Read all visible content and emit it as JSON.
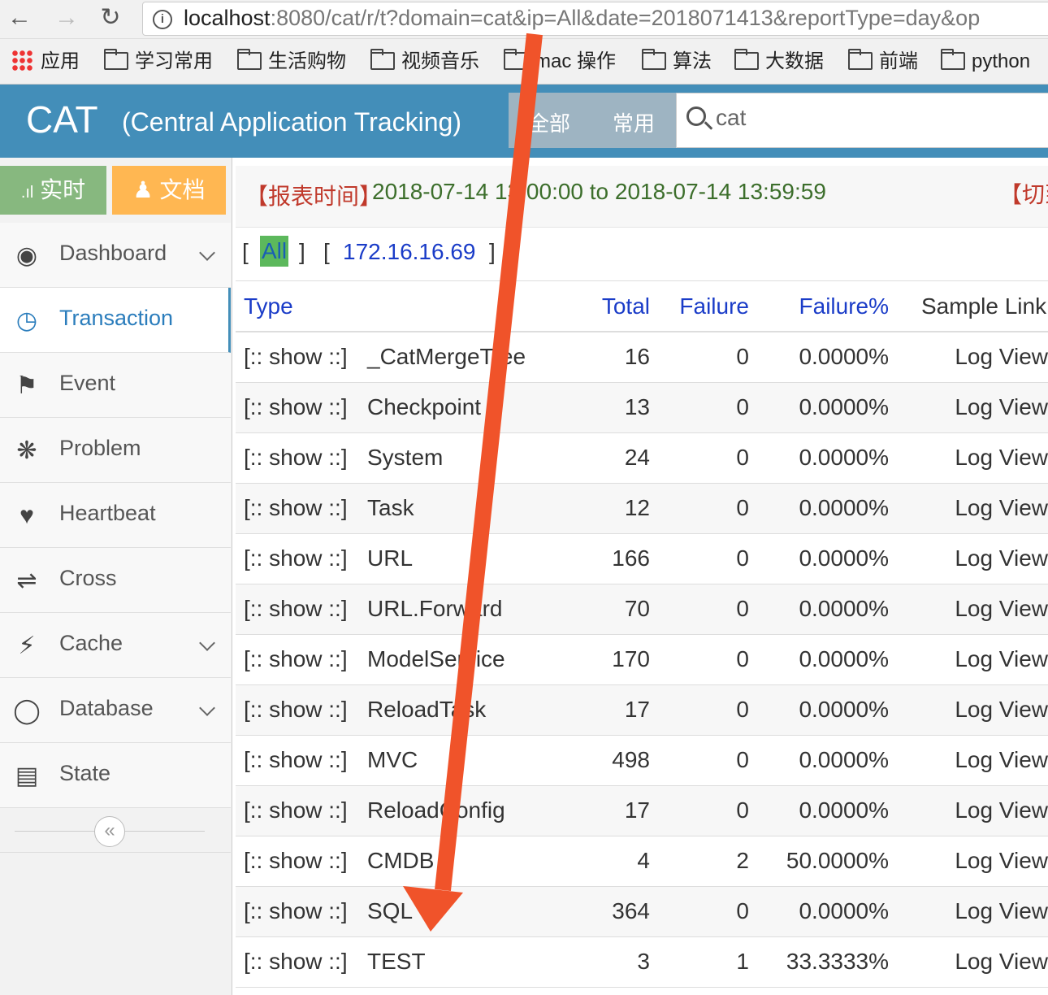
{
  "browser": {
    "url_host": "localhost",
    "url_rest": ":8080/cat/r/t?domain=cat&ip=All&date=2018071413&reportType=day&op",
    "bookmarks": [
      "应用",
      "学习常用",
      "生活购物",
      "视频音乐",
      "mac 操作",
      "算法",
      "大数据",
      "前端",
      "python"
    ]
  },
  "header": {
    "title": "CAT",
    "subtitle": "(Central Application Tracking)",
    "seg_all": "全部",
    "seg_common": "常用",
    "search_value": "cat"
  },
  "sidebar": {
    "btn_realtime": "实时",
    "btn_docs": "文档",
    "items": [
      {
        "label": "Dashboard"
      },
      {
        "label": "Transaction"
      },
      {
        "label": "Event"
      },
      {
        "label": "Problem"
      },
      {
        "label": "Heartbeat"
      },
      {
        "label": "Cross"
      },
      {
        "label": "Cache"
      },
      {
        "label": "Database"
      },
      {
        "label": "State"
      }
    ],
    "collapse_glyph": "«"
  },
  "report": {
    "label": "【报表时间】",
    "time_range": "2018-07-14 13:00:00 to 2018-07-14 13:59:59",
    "switch_label": "【切到"
  },
  "ip_filter": {
    "all": "All",
    "ip": "172.16.16.69"
  },
  "table": {
    "headers": {
      "type": "Type",
      "total": "Total",
      "failure": "Failure",
      "failure_pct": "Failure%",
      "sample": "Sample Link"
    },
    "show_text": "[:: show ::]",
    "link_text": "Log View",
    "rows": [
      {
        "type": "_CatMergeTree",
        "total": "16",
        "failure": "0",
        "pct": "0.0000%"
      },
      {
        "type": "Checkpoint",
        "total": "13",
        "failure": "0",
        "pct": "0.0000%"
      },
      {
        "type": "System",
        "total": "24",
        "failure": "0",
        "pct": "0.0000%"
      },
      {
        "type": "Task",
        "total": "12",
        "failure": "0",
        "pct": "0.0000%"
      },
      {
        "type": "URL",
        "total": "166",
        "failure": "0",
        "pct": "0.0000%"
      },
      {
        "type": "URL.Forward",
        "total": "70",
        "failure": "0",
        "pct": "0.0000%"
      },
      {
        "type": "ModelService",
        "total": "170",
        "failure": "0",
        "pct": "0.0000%"
      },
      {
        "type": "ReloadTask",
        "total": "17",
        "failure": "0",
        "pct": "0.0000%"
      },
      {
        "type": "MVC",
        "total": "498",
        "failure": "0",
        "pct": "0.0000%"
      },
      {
        "type": "ReloadConfig",
        "total": "17",
        "failure": "0",
        "pct": "0.0000%"
      },
      {
        "type": "CMDB",
        "total": "4",
        "failure": "2",
        "pct": "50.0000%"
      },
      {
        "type": "SQL",
        "total": "364",
        "failure": "0",
        "pct": "0.0000%"
      },
      {
        "type": "TEST",
        "total": "3",
        "failure": "1",
        "pct": "33.3333%"
      }
    ]
  },
  "annotation": {
    "arrow_color": "#f0532a"
  }
}
